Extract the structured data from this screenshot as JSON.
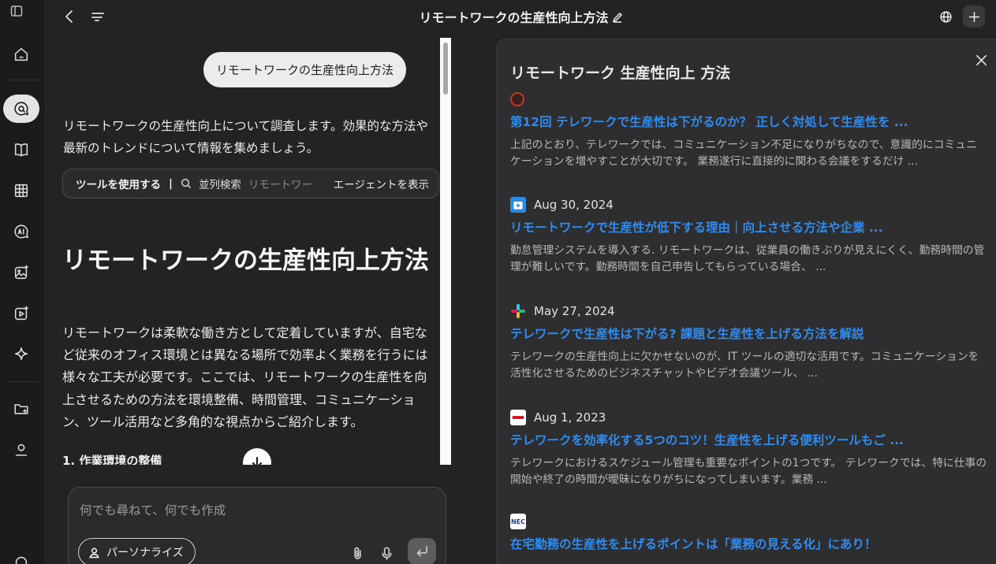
{
  "header": {
    "title": "リモートワークの生産性向上方法"
  },
  "chat": {
    "user_message": "リモートワークの生産性向上方法",
    "intro": "リモートワークの生産性向上について調査します。効果的な方法や最新のトレンドについて情報を集めましょう。",
    "tools": {
      "label": "ツールを使用する",
      "separator": "|",
      "search_type": "並列検索",
      "query": "リモートワー",
      "agent_button": "エージェントを表示"
    },
    "heading": "リモートワークの生産性向上方法",
    "paragraph": "リモートワークは柔軟な働き方として定着していますが、自宅など従来のオフィス環境とは異なる場所で効率よく業務を行うには様々な工夫が必要です。ここでは、リモートワークの生産性を向上させるための方法を環境整備、時間管理、コミュニケーション、ツール活用など多角的な視点からご紹介します。",
    "section_heading": "1. 作業環境の整備"
  },
  "composer": {
    "placeholder": "何でも尋ねて、何でも作成",
    "personalize_label": "パーソナライズ"
  },
  "panel": {
    "title": "リモートワーク 生産性向上 方法",
    "sources": [
      {
        "date": "",
        "favicon_color": "#c0392b",
        "title": "第12回 テレワークで生産性は下がるのか？ 正しく対処して生産性を ...",
        "snippet": "上記のとおり、テレワークでは、コミュニケーション不足になりがちなので、意識的にコミュニケーションを増やすことが大切です。 業務遂行に直接的に関わる会議をするだけ ..."
      },
      {
        "date": "Aug 30, 2024",
        "favicon_color": "#2a8de0",
        "title": "リモートワークで生産性が低下する理由｜向上させる方法や企業 ...",
        "snippet": "勤怠管理システムを導入する. リモートワークは、従業員の働きぶりが見えにくく、勤務時間の管理が難しいです。勤務時間を自己申告してもらっている場合、 ..."
      },
      {
        "date": "May 27, 2024",
        "favicon_color": "#e01e5a",
        "title": "テレワークで生産性は下がる? 課題と生産性を上げる方法を解説",
        "snippet": "テレワークの生産性向上に欠かせないのが、IT ツールの適切な活用です。コミュニケーションを活性化させるためのビジネスチャットやビデオ会議ツール、 ..."
      },
      {
        "date": "Aug 1, 2023",
        "favicon_color": "#d6001c",
        "title": "テレワークを効率化する5つのコツ！生産性を上げる便利ツールもご ...",
        "snippet": "テレワークにおけるスケジュール管理も重要なポイントの1つです。 テレワークでは、特に仕事の開始や終了の時間が曖昧になりがちになってしまいます。業務 ..."
      },
      {
        "date": "",
        "favicon_color": "#1e3c96",
        "favicon_text": "NEC",
        "title": "在宅勤務の生産性を上げるポイントは「業務の見える化」にあり！",
        "snippet": ""
      }
    ]
  }
}
